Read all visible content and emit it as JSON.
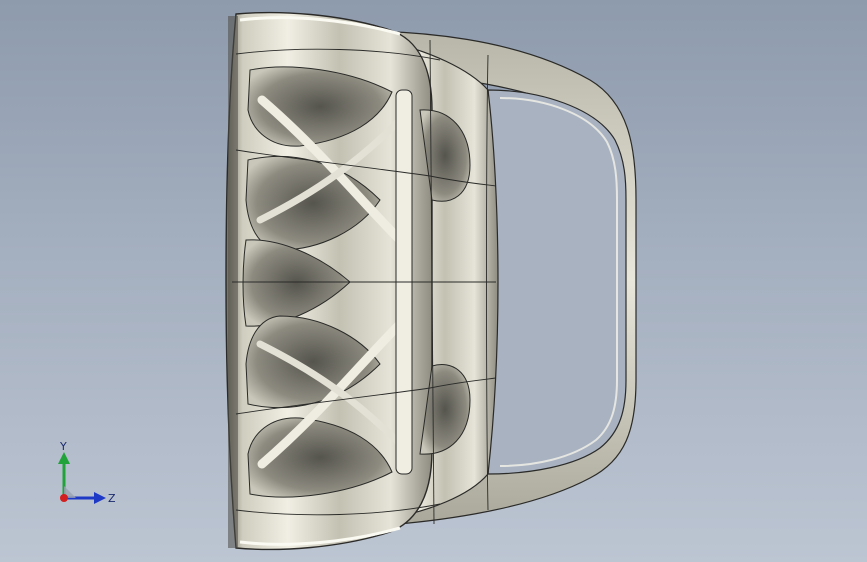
{
  "viewport": {
    "background_top": "#8e9bad",
    "background_bottom": "#bcc5d2"
  },
  "part": {
    "kind": "lattice bracket with D-shaped handle loop",
    "body_color": "#d3d1c3",
    "edge_color": "#2a2a28"
  },
  "triad": {
    "y_label": "Y",
    "z_label": "Z",
    "x_color": "#d21f1f",
    "y_color": "#22a33a",
    "z_color": "#1f39c7"
  }
}
